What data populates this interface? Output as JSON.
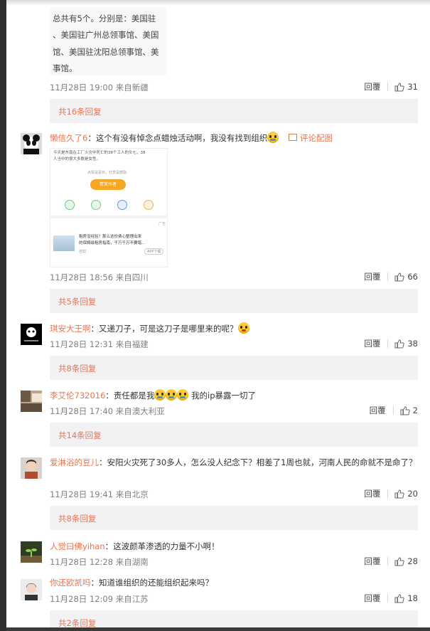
{
  "colors": {
    "accent": "#eb7350",
    "meta": "#808080",
    "reply_bg": "#f2f2f5"
  },
  "top_image": {
    "lines": [
      "总共有5个。分别是：美国驻",
      "、美国驻广州总领事馆、美国",
      "馆、美国驻沈阳总领事馆、美",
      "事馆。"
    ]
  },
  "c1": {
    "time": "11月28日 19:00",
    "from": "来自新疆",
    "reply": "回覆",
    "likes": "31",
    "replies": "共16条回复"
  },
  "c2": {
    "user": "懒信久了6",
    "text": "：这个有没有悼念点蜡烛活动啊，我没有找到组织",
    "pic_link": "评论配图",
    "img": {
      "line1": "今天是东南在工厂火灾中死亡的38个工人的头七，38",
      "line2": "人当中的很大多数是女性。",
      "share": "点赞是喜欢，打赏是鼓励",
      "btn": "赞赏作者",
      "ad_tag": "广告",
      "ad_line1": "租房没经验？那么这份费心整理出来",
      "ad_line2": "的保姆级租房指南，千万千万不要错...",
      "ad_src": "自如",
      "ad_btn": "APP下载"
    },
    "time": "11月28日 18:56",
    "from": "来自四川",
    "reply": "回覆",
    "likes": "66",
    "replies": "共5条回复"
  },
  "c3": {
    "user": "琪安大王啊",
    "text": "：又递刀子，可是这刀子是哪里来的呢？",
    "time": "11月28日 12:31",
    "from": "来自福建",
    "reply": "回覆",
    "likes": "38",
    "replies": "共8条回复"
  },
  "c4": {
    "user": "李艾伦732016",
    "text_a": "：责任都是我",
    "text_b": "我的ip暴露一切了",
    "time": "11月28日 17:40",
    "from": "来自澳大利亚",
    "reply": "回覆",
    "likes": "2",
    "replies": "共14条回复"
  },
  "c5": {
    "user": "爱淋浴的豆儿",
    "text": "：安阳火灾死了30多人，怎么没人纪念下？相差了1周也就，河南人民的命就不是命了？",
    "time": "11月28日 19:41",
    "from": "来自北京",
    "reply": "回覆",
    "likes": "20",
    "replies": "共8条回复"
  },
  "c6": {
    "user": "人觉曰佛yihan",
    "text": "：这波颜革渗透的力量不小啊！",
    "time": "11月28日 12:28",
    "from": "来自湖南",
    "reply": "回覆",
    "likes": "28"
  },
  "c7": {
    "user": "你还欧凯吗",
    "text": "：知道谁组织的还能组织起来吗？",
    "time": "11月28日 12:09",
    "from": "来自江苏",
    "reply": "回覆",
    "likes": "18",
    "replies": "共2条回复"
  }
}
